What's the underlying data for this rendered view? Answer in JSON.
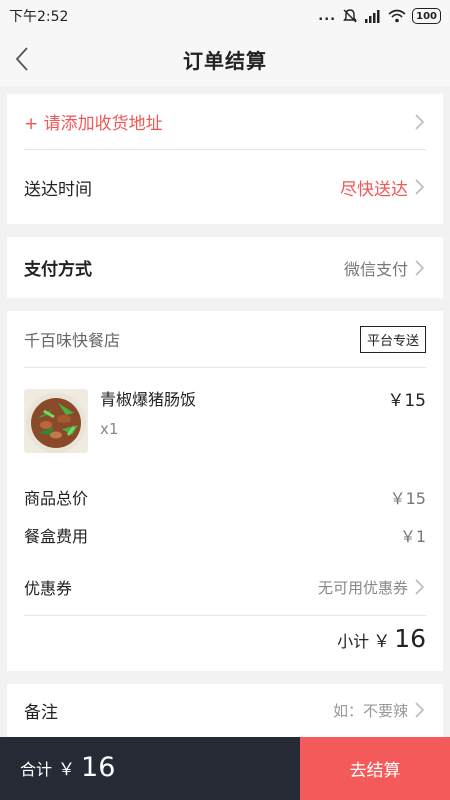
{
  "status_bar": {
    "time": "下午2:52",
    "signal_text": "...",
    "battery": "100"
  },
  "nav": {
    "title": "订单结算"
  },
  "address": {
    "add_label": "+ 请添加收货地址"
  },
  "delivery_time": {
    "label": "送达时间",
    "value": "尽快送达"
  },
  "payment": {
    "label": "支付方式",
    "value": "微信支付"
  },
  "shop": {
    "name": "千百味快餐店",
    "delivery_badge": "平台专送"
  },
  "dish": {
    "name": "青椒爆猪肠饭",
    "quantity": "x1",
    "price": "￥15"
  },
  "fees": {
    "goods_total_label": "商品总价",
    "goods_total_value": "￥15",
    "box_fee_label": "餐盒费用",
    "box_fee_value": "￥1"
  },
  "coupon": {
    "label": "优惠券",
    "value": "无可用优惠券"
  },
  "subtotal": {
    "label": "小计",
    "currency": "￥",
    "value": "16"
  },
  "remark": {
    "label": "备注",
    "placeholder": "如：不要辣"
  },
  "bottom": {
    "total_label": "合计",
    "currency": "￥",
    "total_value": "16",
    "checkout_label": "去结算"
  },
  "colors": {
    "accent_red": "#f25656",
    "bottom_dark": "#252a35",
    "checkout_red": "#f45a5a"
  }
}
